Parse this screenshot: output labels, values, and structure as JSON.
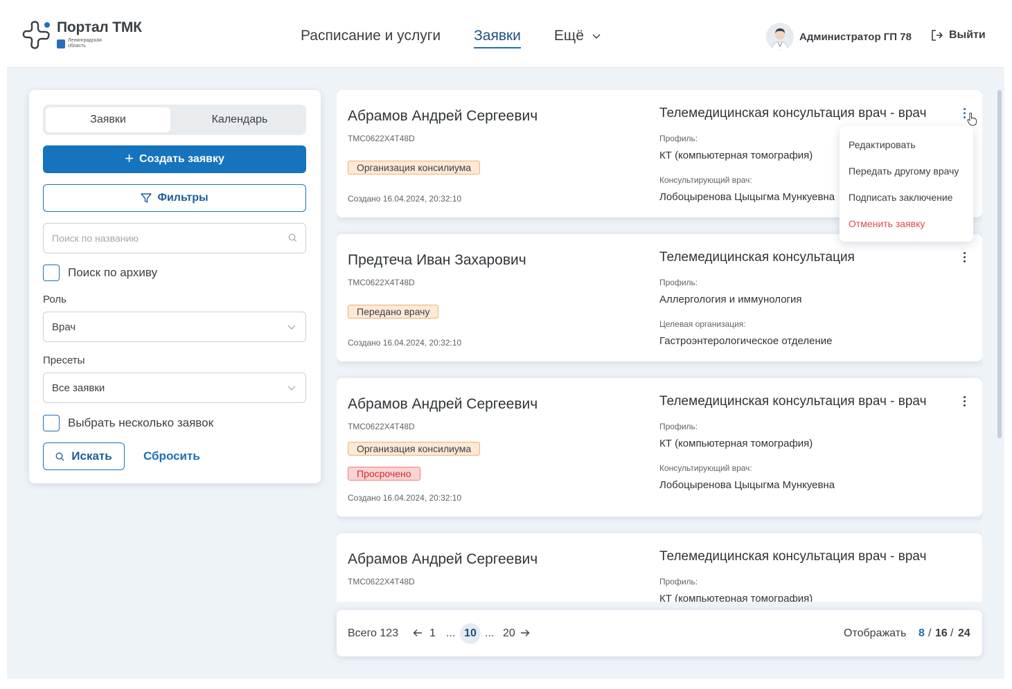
{
  "header": {
    "logo_title": "Портал ТМК",
    "logo_sub": "Ленинградская область",
    "nav": [
      "Расписание и услуги",
      "Заявки",
      "Ещё"
    ],
    "user_name": "Администратор ГП 78",
    "logout": "Выйти"
  },
  "sidebar": {
    "tab_requests": "Заявки",
    "tab_calendar": "Календарь",
    "create_button": "Создать заявку",
    "filters_button": "Фильтры",
    "search_placeholder": "Поиск по названию",
    "archive_check": "Поиск по архиву",
    "role_label": "Роль",
    "role_value": "Врач",
    "presets_label": "Пресеты",
    "presets_value": "Все заявки",
    "multi_check": "Выбрать несколько заявок",
    "search_button": "Искать",
    "reset_button": "Сбросить"
  },
  "cards": [
    {
      "name": "Абрамов Андрей Сергеевич",
      "id": "TMC0622X4T48D",
      "badges": [
        "Организация консилиума"
      ],
      "created": "Создано 16.04.2024, 20:32:10",
      "title": "Телемедицинская консультация врач - врач",
      "label1": "Профиль:",
      "value1": "КТ (компьютерная томография)",
      "label2": "Консультирующий врач:",
      "value2": "Лобоцыренова Цыцыгма Мункуевна"
    },
    {
      "name": "Предтеча Иван Захарович",
      "id": "TMC0622X4T48D",
      "badges": [
        "Передано врачу"
      ],
      "created": "Создано 16.04.2024, 20:32:10",
      "title": "Телемедицинская консультация",
      "label1": "Профиль:",
      "value1": "Аллергология и иммунология",
      "label2": "Целевая организация:",
      "value2": "Гастроэнтерологическое отделение"
    },
    {
      "name": "Абрамов Андрей Сергеевич",
      "id": "TMC0622X4T48D",
      "badges": [
        "Организация консилиума",
        "Просрочено"
      ],
      "created": "Создано 16.04.2024, 20:32:10",
      "title": "Телемедицинская консультация врач - врач",
      "label1": "Профиль:",
      "value1": "КТ (компьютерная томография)",
      "label2": "Консультирующий врач:",
      "value2": "Лобоцыренова Цыцыгма Мункуевна"
    },
    {
      "name": "Абрамов Андрей Сергеевич",
      "id": "TMC0622X4T48D",
      "title": "Телемедицинская консультация врач - врач",
      "label1": "Профиль:",
      "value1": "КТ (компьютерная томография)"
    }
  ],
  "context_menu": [
    "Редактировать",
    "Передать другому врачу",
    "Подписать заключение",
    "Отменить заявку"
  ],
  "pagination": {
    "total": "Всего 123",
    "pages": [
      "1",
      "...",
      "10",
      "...",
      "20"
    ],
    "current": "10",
    "show_label": "Отображать",
    "sizes": [
      "8",
      "16",
      "24"
    ],
    "size_sep": "/"
  },
  "colors": {
    "accent": "#1673bd",
    "danger": "#e04848",
    "background": "#eef3f8"
  }
}
